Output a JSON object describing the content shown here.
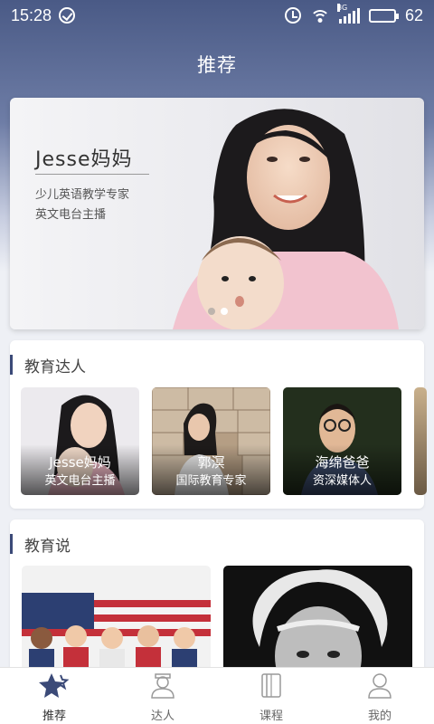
{
  "status_bar": {
    "time": "15:28",
    "network": "3G",
    "battery": "62",
    "battery_level": 0.62
  },
  "page_title": "推荐",
  "hero": {
    "name": "Jesse妈妈",
    "line1": "少儿英语教学专家",
    "line2": "英文电台主播",
    "dots_total": 2,
    "dots_active": 2
  },
  "experts_section": {
    "title": "教育达人",
    "items": [
      {
        "name": "Jesse妈妈",
        "desc": "英文电台主播"
      },
      {
        "name": "郭溟",
        "desc": "国际教育专家"
      },
      {
        "name": "海绵爸爸",
        "desc": "资深媒体人"
      }
    ]
  },
  "talks_section": {
    "title": "教育说"
  },
  "tabbar": {
    "tabs": [
      {
        "label": "推荐",
        "icon": "star-icon",
        "active": true
      },
      {
        "label": "达人",
        "icon": "expert-icon",
        "active": false
      },
      {
        "label": "课程",
        "icon": "book-icon",
        "active": false
      },
      {
        "label": "我的",
        "icon": "user-icon",
        "active": false
      }
    ]
  },
  "colors": {
    "accent": "#3b4a78",
    "header_bg": "#4a5a86"
  }
}
